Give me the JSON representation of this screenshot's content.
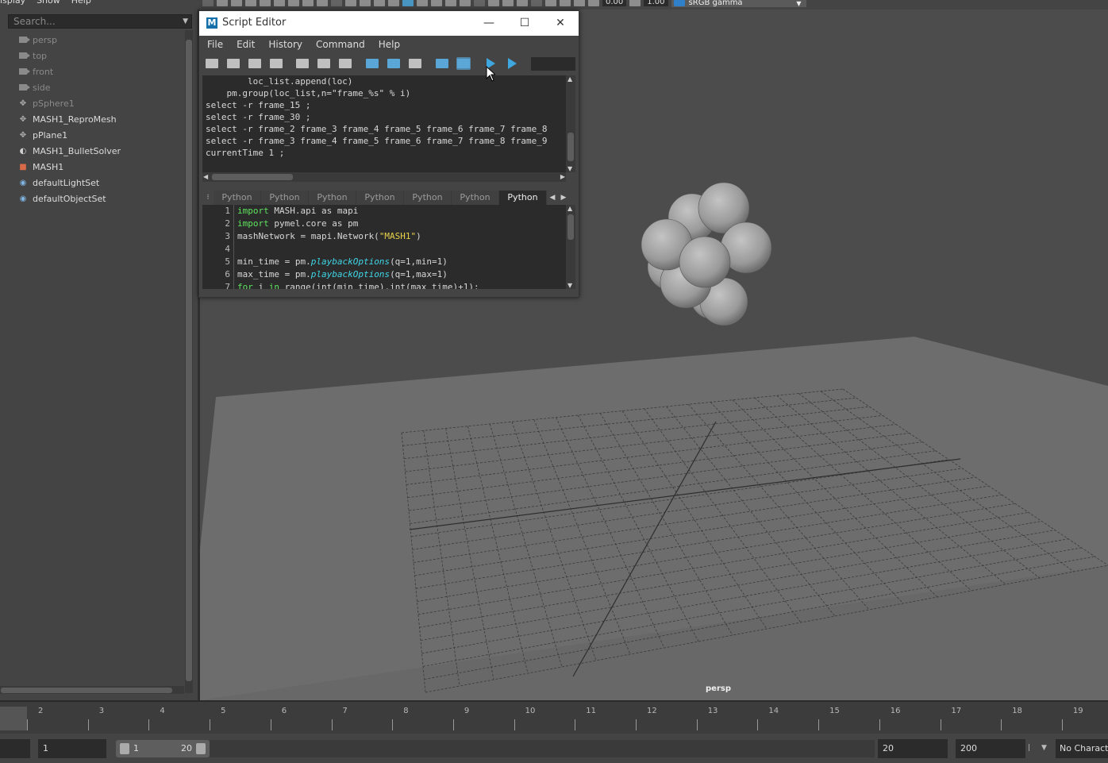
{
  "outliner": {
    "menus": [
      "isplay",
      "Show",
      "Help"
    ],
    "search_placeholder": "Search...",
    "items": [
      {
        "label": "persp",
        "icon": "camera-icon",
        "dim": true
      },
      {
        "label": "top",
        "icon": "camera-icon",
        "dim": true
      },
      {
        "label": "front",
        "icon": "camera-icon",
        "dim": true
      },
      {
        "label": "side",
        "icon": "camera-icon",
        "dim": true
      },
      {
        "label": "pSphere1",
        "icon": "transform-icon",
        "dim": true
      },
      {
        "label": "MASH1_ReproMesh",
        "icon": "transform-icon",
        "dim": false
      },
      {
        "label": "pPlane1",
        "icon": "transform-icon",
        "dim": false
      },
      {
        "label": "MASH1_BulletSolver",
        "icon": "bullet-solver-icon",
        "dim": false
      },
      {
        "label": "MASH1",
        "icon": "mash-waiter-icon",
        "dim": false
      },
      {
        "label": "defaultLightSet",
        "icon": "set-icon",
        "dim": false
      },
      {
        "label": "defaultObjectSet",
        "icon": "set-icon",
        "dim": false
      }
    ]
  },
  "viewport_toolbar": {
    "exposure": "0.00",
    "gamma": "1.00",
    "colorspace": "sRGB gamma"
  },
  "viewport": {
    "camera_label": "persp"
  },
  "script_editor": {
    "logo": "M",
    "title": "Script Editor",
    "menus": [
      "File",
      "Edit",
      "History",
      "Command",
      "Help"
    ],
    "history_lines": [
      "        loc_list.append(loc)",
      "    pm.group(loc_list,n=\"frame_%s\" % i)",
      "select -r frame_15 ;",
      "select -r frame_30 ;",
      "select -r frame_2 frame_3 frame_4 frame_5 frame_6 frame_7 frame_8",
      "select -r frame_3 frame_4 frame_5 frame_6 frame_7 frame_8 frame_9",
      "currentTime 1 ;"
    ],
    "tabs": [
      "Python",
      "Python",
      "Python",
      "Python",
      "Python",
      "Python",
      "Python"
    ],
    "active_tab": 6,
    "code_lines": [
      {
        "n": "1",
        "segments": [
          [
            "kw",
            "import"
          ],
          [
            "",
            " MASH.api as mapi"
          ]
        ]
      },
      {
        "n": "2",
        "segments": [
          [
            "kw",
            "import"
          ],
          [
            "",
            " pymel.core as pm"
          ]
        ]
      },
      {
        "n": "3",
        "segments": [
          [
            "",
            "mashNetwork = mapi.Network("
          ],
          [
            "str",
            "\"MASH1\""
          ],
          [
            "",
            ")"
          ]
        ]
      },
      {
        "n": "4",
        "segments": [
          [
            "",
            ""
          ]
        ]
      },
      {
        "n": "5",
        "segments": [
          [
            "",
            "min_time = pm."
          ],
          [
            "fn",
            "playbackOptions"
          ],
          [
            "",
            "(q=1,min=1)"
          ]
        ]
      },
      {
        "n": "6",
        "segments": [
          [
            "",
            "max_time = pm."
          ],
          [
            "fn",
            "playbackOptions"
          ],
          [
            "",
            "(q=1,max=1)"
          ]
        ]
      },
      {
        "n": "7",
        "segments": [
          [
            "kw",
            "for"
          ],
          [
            "",
            " i "
          ],
          [
            "kw",
            "in"
          ],
          [
            "",
            " range(int(min_time),int(max_time)+1):"
          ]
        ]
      }
    ]
  },
  "timeline": {
    "ticks": [
      "2",
      "3",
      "4",
      "5",
      "6",
      "7",
      "8",
      "9",
      "10",
      "11",
      "12",
      "13",
      "14",
      "15",
      "16",
      "17",
      "18",
      "19"
    ]
  },
  "range_bar": {
    "current_frame": "1",
    "range_start": "1",
    "range_end": "20",
    "end_time": "20",
    "max_time": "200",
    "character_set": "No Character Set"
  }
}
